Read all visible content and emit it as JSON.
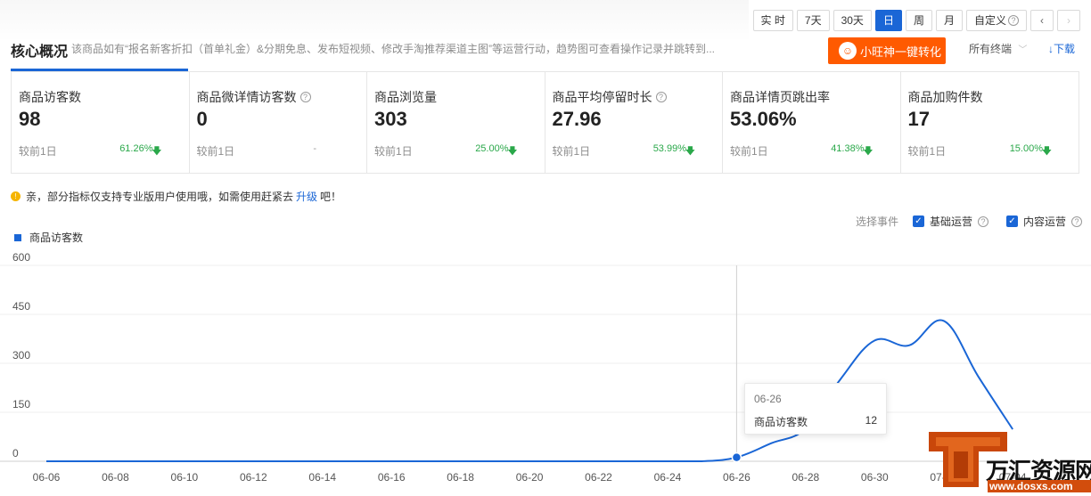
{
  "toolbar": {
    "range_buttons": [
      "实 时",
      "7天",
      "30天",
      "日",
      "周",
      "月",
      "自定义"
    ],
    "active_index": 3,
    "prev": "‹",
    "next": "›"
  },
  "header": {
    "title": "核心概况",
    "description": "该商品如有“报名新客折扣（首单礼金）&分期免息、发布短视频、修改手淘推荐渠道主图”等运营行动，趋势图可查看操作记录并跳转到...",
    "promo_button": "小旺神一键转化",
    "terminal_select": "所有终端",
    "download": "↓下载"
  },
  "metrics": [
    {
      "label": "商品访客数",
      "help": false,
      "value": "98",
      "compare": "较前1日",
      "pct": "61.26%",
      "trend": "down"
    },
    {
      "label": "商品微详情访客数",
      "help": true,
      "value": "0",
      "compare": "较前1日",
      "pct": "-",
      "trend": "none"
    },
    {
      "label": "商品浏览量",
      "help": false,
      "value": "303",
      "compare": "较前1日",
      "pct": "25.00%",
      "trend": "down"
    },
    {
      "label": "商品平均停留时长",
      "help": true,
      "value": "27.96",
      "compare": "较前1日",
      "pct": "53.99%",
      "trend": "down"
    },
    {
      "label": "商品详情页跳出率",
      "help": false,
      "value": "53.06%",
      "compare": "较前1日",
      "pct": "41.38%",
      "trend": "down"
    },
    {
      "label": "商品加购件数",
      "help": false,
      "value": "17",
      "compare": "较前1日",
      "pct": "15.00%",
      "trend": "down"
    }
  ],
  "notice": {
    "text_before": "亲，部分指标仅支持专业版用户使用哦，如需使用赶紧去",
    "link": "升级",
    "text_after": "吧！"
  },
  "events": {
    "label": "选择事件",
    "options": [
      "基础运营",
      "内容运营"
    ]
  },
  "colors": {
    "accent": "#1a66d6",
    "promo": "#ff5a00",
    "down": "#2aa84a"
  },
  "tooltip": {
    "date": "06-26",
    "name": "商品访客数",
    "value": "12"
  },
  "watermark": {
    "brand": "万汇资源网",
    "url": "www.dosxs.com"
  },
  "chart_data": {
    "type": "line",
    "series": [
      {
        "name": "商品访客数"
      }
    ],
    "x_ticks": [
      "06-06",
      "06-08",
      "06-10",
      "06-12",
      "06-14",
      "06-16",
      "06-18",
      "06-20",
      "06-22",
      "06-24",
      "06-26",
      "06-28",
      "06-30",
      "07-02",
      "07-04"
    ],
    "y_ticks": [
      0,
      150,
      300,
      450,
      600
    ],
    "ylim": [
      0,
      600
    ],
    "dates": [
      "06-06",
      "06-07",
      "06-08",
      "06-09",
      "06-10",
      "06-11",
      "06-12",
      "06-13",
      "06-14",
      "06-15",
      "06-16",
      "06-17",
      "06-18",
      "06-19",
      "06-20",
      "06-21",
      "06-22",
      "06-23",
      "06-24",
      "06-25",
      "06-26",
      "06-27",
      "06-28",
      "06-29",
      "06-30",
      "07-01",
      "07-02",
      "07-03",
      "07-04"
    ],
    "values": [
      0,
      0,
      0,
      0,
      0,
      0,
      0,
      0,
      0,
      0,
      0,
      0,
      0,
      0,
      0,
      0,
      0,
      0,
      0,
      0,
      12,
      55,
      100,
      250,
      370,
      355,
      430,
      260,
      98
    ],
    "highlight_index": 20,
    "grid": true,
    "legend": "top-left"
  }
}
